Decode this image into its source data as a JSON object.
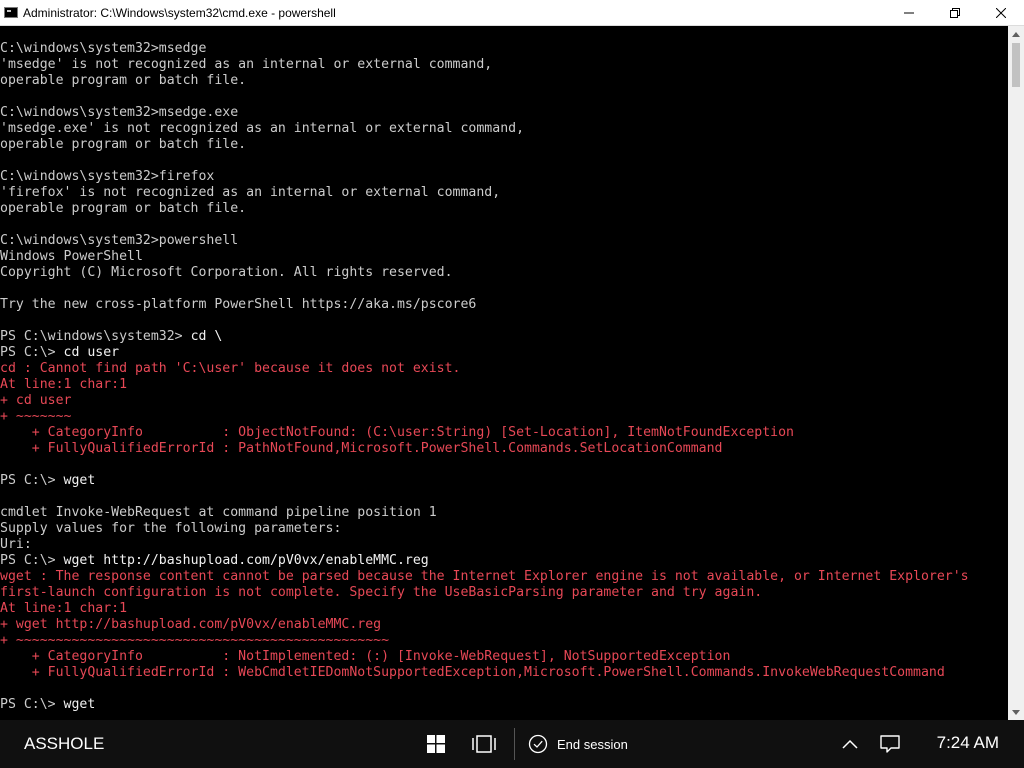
{
  "window": {
    "title": "Administrator: C:\\Windows\\system32\\cmd.exe - powershell",
    "controls": [
      "minimize",
      "maximize",
      "close"
    ]
  },
  "console": {
    "lines": [
      {
        "text": "C:\\windows\\system32>msedge",
        "kind": "normal"
      },
      {
        "text": "'msedge' is not recognized as an internal or external command,",
        "kind": "normal"
      },
      {
        "text": "operable program or batch file.",
        "kind": "normal"
      },
      {
        "text": "",
        "kind": "normal"
      },
      {
        "text": "C:\\windows\\system32>msedge.exe",
        "kind": "normal"
      },
      {
        "text": "'msedge.exe' is not recognized as an internal or external command,",
        "kind": "normal"
      },
      {
        "text": "operable program or batch file.",
        "kind": "normal"
      },
      {
        "text": "",
        "kind": "normal"
      },
      {
        "text": "C:\\windows\\system32>firefox",
        "kind": "normal"
      },
      {
        "text": "'firefox' is not recognized as an internal or external command,",
        "kind": "normal"
      },
      {
        "text": "operable program or batch file.",
        "kind": "normal"
      },
      {
        "text": "",
        "kind": "normal"
      },
      {
        "text": "C:\\windows\\system32>powershell",
        "kind": "normal"
      },
      {
        "text": "Windows PowerShell",
        "kind": "normal"
      },
      {
        "text": "Copyright (C) Microsoft Corporation. All rights reserved.",
        "kind": "normal"
      },
      {
        "text": "",
        "kind": "normal"
      },
      {
        "text": "Try the new cross-platform PowerShell https://aka.ms/pscore6",
        "kind": "normal"
      },
      {
        "text": "",
        "kind": "normal"
      },
      {
        "text": "PS C:\\windows\\system32> ",
        "cmd": "cd \\",
        "kind": "cmd"
      },
      {
        "text": "PS C:\\> ",
        "cmd": "cd user",
        "kind": "cmd"
      },
      {
        "text": "cd : Cannot find path 'C:\\user' because it does not exist.",
        "kind": "error"
      },
      {
        "text": "At line:1 char:1",
        "kind": "error"
      },
      {
        "text": "+ cd user",
        "kind": "error"
      },
      {
        "text": "+ ~~~~~~~",
        "kind": "error"
      },
      {
        "text": "    + CategoryInfo          : ObjectNotFound: (C:\\user:String) [Set-Location], ItemNotFoundException",
        "kind": "error"
      },
      {
        "text": "    + FullyQualifiedErrorId : PathNotFound,Microsoft.PowerShell.Commands.SetLocationCommand",
        "kind": "error"
      },
      {
        "text": "",
        "kind": "normal"
      },
      {
        "text": "PS C:\\> ",
        "cmd": "wget",
        "kind": "cmd"
      },
      {
        "text": "",
        "kind": "normal"
      },
      {
        "text": "cmdlet Invoke-WebRequest at command pipeline position 1",
        "kind": "normal"
      },
      {
        "text": "Supply values for the following parameters:",
        "kind": "normal"
      },
      {
        "text": "Uri:",
        "kind": "normal"
      },
      {
        "text": "PS C:\\> ",
        "cmd": "wget http://bashupload.com/pV0vx/enableMMC.reg",
        "kind": "cmd"
      },
      {
        "text": "wget : The response content cannot be parsed because the Internet Explorer engine is not available, or Internet Explorer's",
        "kind": "error"
      },
      {
        "text": "first-launch configuration is not complete. Specify the UseBasicParsing parameter and try again.",
        "kind": "error"
      },
      {
        "text": "At line:1 char:1",
        "kind": "error"
      },
      {
        "text": "+ wget http://bashupload.com/pV0vx/enableMMC.reg",
        "kind": "error"
      },
      {
        "text": "+ ~~~~~~~~~~~~~~~~~~~~~~~~~~~~~~~~~~~~~~~~~~~~~~~",
        "kind": "error"
      },
      {
        "text": "    + CategoryInfo          : NotImplemented: (:) [Invoke-WebRequest], NotSupportedException",
        "kind": "error"
      },
      {
        "text": "    + FullyQualifiedErrorId : WebCmdletIEDomNotSupportedException,Microsoft.PowerShell.Commands.InvokeWebRequestCommand",
        "kind": "error"
      },
      {
        "text": "",
        "kind": "normal"
      },
      {
        "text": "PS C:\\> ",
        "cmd": "wget",
        "kind": "cmd"
      }
    ]
  },
  "taskbar": {
    "label": "ASSHOLE",
    "end_session_label": "End session",
    "time": "7:24 AM",
    "icons": [
      "windows-start-icon",
      "task-view-icon",
      "end-session-icon",
      "chevron-up-icon",
      "notification-icon"
    ]
  },
  "colors": {
    "console_text": "#cccccc",
    "error_text": "#e74856",
    "console_bg": "#000000",
    "taskbar_bg": "#101010"
  }
}
